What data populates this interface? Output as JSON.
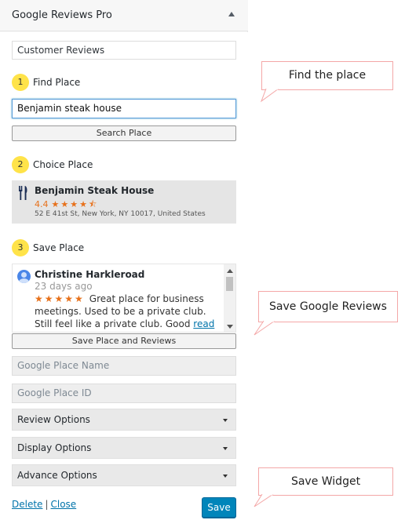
{
  "widget": {
    "title": "Google Reviews Pro",
    "title_field_value": "Customer Reviews",
    "steps": [
      {
        "num": "1",
        "label": "Find Place"
      },
      {
        "num": "2",
        "label": "Choice Place"
      },
      {
        "num": "3",
        "label": "Save Place"
      }
    ],
    "search_value": "Benjamin steak house",
    "search_button": "Search Place",
    "place": {
      "name": "Benjamin Steak House",
      "rating": "4.4",
      "stars": "★★★★⯪",
      "address": "52 E 41st St, New York, NY 10017, United States"
    },
    "review": {
      "author": "Christine Harkleroad",
      "time": "23 days ago",
      "stars": "★★★★★",
      "text": "Great place for business meetings.  Used to be a private club. Still feel like a private club. Good",
      "read_more": "read more"
    },
    "save_place_button": "Save Place and Reviews",
    "place_name_placeholder": "Google Place Name",
    "place_id_placeholder": "Google Place ID",
    "options": [
      "Review Options",
      "Display Options",
      "Advance Options"
    ],
    "delete_link": "Delete",
    "separator": "|",
    "close_link": "Close",
    "save_button": "Save"
  },
  "callouts": {
    "find": "Find the place",
    "save_reviews": "Save Google Reviews",
    "save_widget": "Save Widget"
  },
  "colors": {
    "step_badge": "#ffe349",
    "star": "#e7711b",
    "primary": "#0085ba",
    "callout_border": "#f4a7a7"
  }
}
